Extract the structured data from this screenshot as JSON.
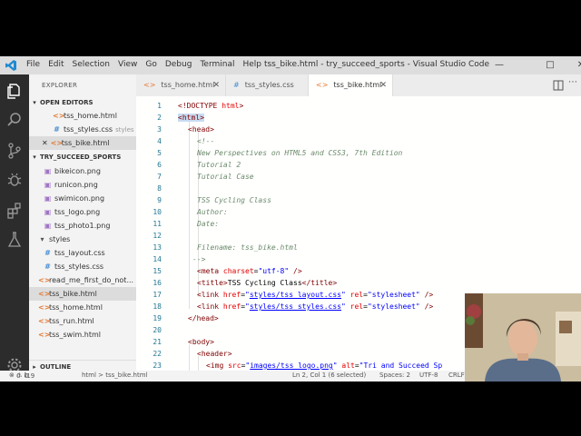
{
  "window_title": "tss_bike.html - try_succeed_sports - Visual Studio Code",
  "menu": [
    "File",
    "Edit",
    "Selection",
    "View",
    "Go",
    "Debug",
    "Terminal",
    "Help"
  ],
  "sidebar": {
    "header": "EXPLORER",
    "open_editors_title": "OPEN EDITORS",
    "open_editors": [
      {
        "name": "tss_home.html",
        "type": "html"
      },
      {
        "name": "tss_styles.css",
        "type": "css",
        "extra": "styles"
      },
      {
        "name": "tss_bike.html",
        "type": "html",
        "active": true
      }
    ],
    "project_title": "TRY_SUCCEED_SPORTS",
    "files": [
      {
        "name": "bikeicon.png",
        "type": "png"
      },
      {
        "name": "runicon.png",
        "type": "png"
      },
      {
        "name": "swimicon.png",
        "type": "png"
      },
      {
        "name": "tss_logo.png",
        "type": "png"
      },
      {
        "name": "tss_photo1.png",
        "type": "png"
      },
      {
        "name": "styles",
        "type": "folder"
      },
      {
        "name": "tss_layout.css",
        "type": "css"
      },
      {
        "name": "tss_styles.css",
        "type": "css"
      },
      {
        "name": "read_me_first_do_not...",
        "type": "html"
      },
      {
        "name": "tss_bike.html",
        "type": "html",
        "selected": true
      },
      {
        "name": "tss_home.html",
        "type": "html"
      },
      {
        "name": "tss_run.html",
        "type": "html"
      },
      {
        "name": "tss_swim.html",
        "type": "html"
      }
    ],
    "outline_title": "OUTLINE"
  },
  "tabs": [
    {
      "label": "tss_home.html",
      "type": "html"
    },
    {
      "label": "tss_styles.css",
      "type": "css"
    },
    {
      "label": "tss_bike.html",
      "type": "html",
      "active": true
    }
  ],
  "code_lines": [
    {
      "n": "1",
      "text": "<!DOCTYPE html>"
    },
    {
      "n": "2",
      "text": "<html>"
    },
    {
      "n": "3",
      "text": "<head>"
    },
    {
      "n": "4",
      "text": "<!--"
    },
    {
      "n": "5",
      "text": "New Perspectives on HTML5 and CSS3, 7th Edition"
    },
    {
      "n": "6",
      "text": "Tutorial 2"
    },
    {
      "n": "7",
      "text": "Tutorial Case"
    },
    {
      "n": "8",
      "text": ""
    },
    {
      "n": "9",
      "text": "TSS Cycling Class"
    },
    {
      "n": "10",
      "text": "Author:"
    },
    {
      "n": "11",
      "text": "Date:"
    },
    {
      "n": "12",
      "text": ""
    },
    {
      "n": "13",
      "text": "Filename: tss_bike.html"
    },
    {
      "n": "14",
      "text": "-->"
    },
    {
      "n": "15",
      "text": "<meta charset=\"utf-8\" />"
    },
    {
      "n": "16",
      "text": "<title>TSS Cycling Class</title>"
    },
    {
      "n": "17",
      "text": "<link href=\"styles/tss_layout.css\" rel=\"stylesheet\" />"
    },
    {
      "n": "18",
      "text": "<link href=\"styles/tss_styles.css\" rel=\"stylesheet\" />"
    },
    {
      "n": "19",
      "text": "</head>"
    },
    {
      "n": "20",
      "text": ""
    },
    {
      "n": "21",
      "text": "<body>"
    },
    {
      "n": "22",
      "text": "<header>"
    },
    {
      "n": "23",
      "text": "<img src=\"images/tss_logo.png\" alt=\"Tri and Succeed Sp"
    }
  ],
  "status": {
    "errors": "0",
    "warnings": "0",
    "count": "19",
    "breadcrumb": "html > tss_bike.html",
    "position": "Ln 2, Col 1 (6 selected)",
    "spaces": "Spaces: 2",
    "encoding": "UTF-8",
    "eol": "CRLF"
  }
}
